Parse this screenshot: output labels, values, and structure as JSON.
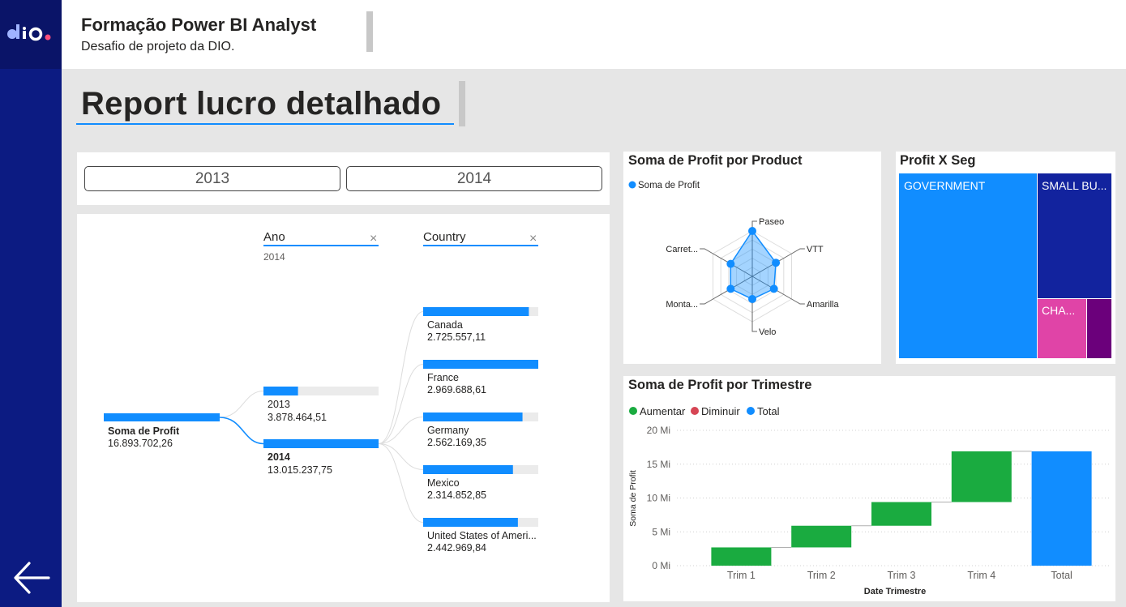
{
  "header": {
    "title": "Formação Power BI Analyst",
    "subtitle": "Desafio de projeto da DIO."
  },
  "page": {
    "title": "Report lucro detalhado"
  },
  "colors": {
    "sidebar": "#0c1b82",
    "accent": "#118dff",
    "increase": "#1aab40",
    "decrease": "#d64554",
    "total": "#118dff",
    "gov": "#118dff",
    "small_business": "#12239e",
    "channel": "#e044a7",
    "other": "#6b007b"
  },
  "year_slicer": {
    "options": [
      "2013",
      "2014"
    ]
  },
  "decomposition": {
    "root": {
      "label": "Soma de Profit",
      "value": "16.893.702,26"
    },
    "levels": [
      {
        "header": "Ano",
        "filter": "2014"
      },
      {
        "header": "Country",
        "filter": ""
      }
    ],
    "years": [
      {
        "label": "2013",
        "value": "3.878.464,51",
        "fraction": 0.3,
        "selected": false
      },
      {
        "label": "2014",
        "value": "13.015.237,75",
        "fraction": 1.0,
        "selected": true
      }
    ],
    "countries": [
      {
        "label": "Canada",
        "value": "2.725.557,11",
        "fraction": 0.918
      },
      {
        "label": "France",
        "value": "2.969.688,61",
        "fraction": 1.0
      },
      {
        "label": "Germany",
        "value": "2.562.169,35",
        "fraction": 0.863
      },
      {
        "label": "Mexico",
        "value": "2.314.852,85",
        "fraction": 0.78
      },
      {
        "label": "United States of Ameri...",
        "value": "2.442.969,84",
        "fraction": 0.823
      }
    ]
  },
  "radar": {
    "title": "Soma de Profit por Product",
    "legend": "Soma de Profit",
    "chart_data": {
      "type": "radar",
      "categories": [
        "Paseo",
        "VTT",
        "Amarilla",
        "Velo",
        "Monta...",
        "Carret..."
      ],
      "values": [
        1.0,
        0.6,
        0.55,
        0.5,
        0.55,
        0.55
      ],
      "value_scale": "relative (0-1)"
    }
  },
  "treemap": {
    "title": "Profit X Seg",
    "chart_data": {
      "type": "treemap",
      "segments": [
        {
          "label": "GOVERNMENT",
          "color": "#118dff"
        },
        {
          "label": "SMALL BU...",
          "color": "#12239e"
        },
        {
          "label": "CHA...",
          "color": "#e044a7"
        },
        {
          "label": "",
          "color": "#6b007b"
        }
      ]
    }
  },
  "waterfall": {
    "title": "Soma de Profit por Trimestre",
    "legend": [
      {
        "label": "Aumentar",
        "color": "#1aab40"
      },
      {
        "label": "Diminuir",
        "color": "#d64554"
      },
      {
        "label": "Total",
        "color": "#118dff"
      }
    ],
    "chart_data": {
      "type": "waterfall",
      "categories": [
        "Trim 1",
        "Trim 2",
        "Trim 3",
        "Trim 4",
        "Total"
      ],
      "values": [
        2.7,
        3.2,
        3.5,
        7.5,
        16.9
      ],
      "xlabel": "Date Trimestre",
      "ylabel": "Soma de Profit",
      "ylim": [
        0,
        20
      ],
      "yticks": [
        "0 Mi",
        "5 Mi",
        "10 Mi",
        "15 Mi",
        "20 Mi"
      ],
      "ytick_values": [
        0,
        5,
        10,
        15,
        20
      ]
    }
  }
}
